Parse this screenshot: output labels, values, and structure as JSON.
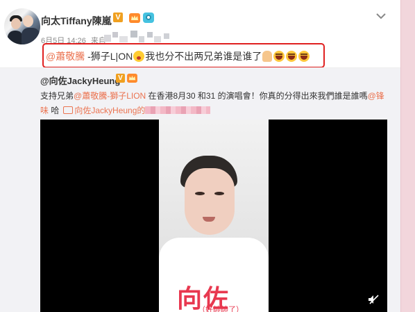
{
  "post": {
    "author": "向太Tiffany陳嵐",
    "verified_badge": "V",
    "meta_date": "6月5日 14:26",
    "meta_from": "来自",
    "text": {
      "mention": "@蕭敬騰",
      "body": " -狮子L|ON",
      "body2": "我也分不出两兄弟谁是谁了"
    }
  },
  "repost": {
    "author": "@向佐JackyHeung",
    "verified_badge": "V",
    "line1_prefix": "支持兄弟",
    "line1_mention": "@蕭敬騰-獅子LION",
    "line1_suffix": " 在香港8月30 和31 的演唱會！你真的分得出來我們誰是誰嗎",
    "line1_mention2": "@锋",
    "line2_mention2_cont": "味",
    "line2_text": " 哈",
    "link_text": "向佐JackyHeung的"
  },
  "video": {
    "caption": "向佐",
    "subcaption": "（好帥帥了）"
  },
  "icons": {
    "chevron": "chevron-down-icon",
    "crown": "crown-icon",
    "camera": "camera-icon",
    "mute": "mute-icon",
    "link": "link-icon"
  },
  "colors": {
    "mention": "#eb7350",
    "highlight_border": "#e02020",
    "caption": "#e8384f"
  }
}
